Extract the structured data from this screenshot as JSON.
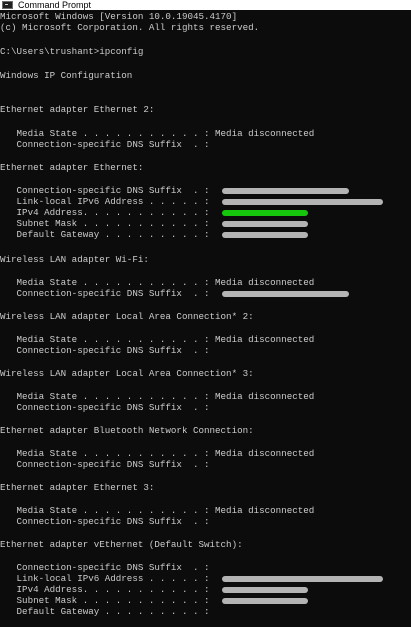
{
  "window": {
    "title": "Command Prompt",
    "icon": "command-prompt-icon"
  },
  "console": {
    "banner_line1": "Microsoft Windows [Version 10.0.19045.4170]",
    "banner_line2": "(c) Microsoft Corporation. All rights reserved.",
    "prompt": "C:\\Users\\trushant>ipconfig",
    "heading": "Windows IP Configuration",
    "adapters": [
      {
        "header": "Ethernet adapter Ethernet 2:",
        "rows": [
          "   Media State . . . . . . . . . . . : Media disconnected",
          "   Connection-specific DNS Suffix  . :"
        ]
      },
      {
        "header": "Ethernet adapter Ethernet:",
        "rows": [
          "   Connection-specific DNS Suffix  . :",
          "   Link-local IPv6 Address . . . . . :",
          "   IPv4 Address. . . . . . . . . . . :",
          "   Subnet Mask . . . . . . . . . . . :",
          "   Default Gateway . . . . . . . . . :"
        ]
      },
      {
        "header": "Wireless LAN adapter Wi-Fi:",
        "rows": [
          "   Media State . . . . . . . . . . . : Media disconnected",
          "   Connection-specific DNS Suffix  . :"
        ]
      },
      {
        "header": "Wireless LAN adapter Local Area Connection* 2:",
        "rows": [
          "   Media State . . . . . . . . . . . : Media disconnected",
          "   Connection-specific DNS Suffix  . :"
        ]
      },
      {
        "header": "Wireless LAN adapter Local Area Connection* 3:",
        "rows": [
          "   Media State . . . . . . . . . . . : Media disconnected",
          "   Connection-specific DNS Suffix  . :"
        ]
      },
      {
        "header": "Ethernet adapter Bluetooth Network Connection:",
        "rows": [
          "   Media State . . . . . . . . . . . : Media disconnected",
          "   Connection-specific DNS Suffix  . :"
        ]
      },
      {
        "header": "Ethernet adapter Ethernet 3:",
        "rows": [
          "   Media State . . . . . . . . . . . : Media disconnected",
          "   Connection-specific DNS Suffix  . :"
        ]
      },
      {
        "header": "Ethernet adapter vEthernet (Default Switch):",
        "rows": [
          "   Connection-specific DNS Suffix  . :",
          "   Link-local IPv6 Address . . . . . :",
          "   IPv4 Address. . . . . . . . . . . :",
          "   Subnet Mask . . . . . . . . . . . :",
          "   Default Gateway . . . . . . . . . :"
        ]
      }
    ]
  },
  "colors": {
    "background": "#0c0c0c",
    "text": "#cccccc",
    "redaction": "#b4b4b4",
    "highlight_redaction": "#16c60c"
  }
}
